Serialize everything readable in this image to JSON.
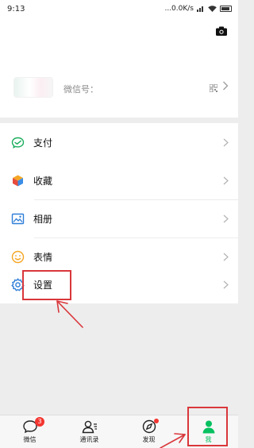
{
  "status_bar": {
    "time": "9:13",
    "network_speed": "...0.0K/s",
    "icons": [
      "signal-icon",
      "wifi-icon",
      "battery-icon"
    ]
  },
  "profile": {
    "wechat_id_label": "微信号：",
    "icons": [
      "camera-icon",
      "qr-code-icon",
      "chevron-right-icon"
    ]
  },
  "menu": {
    "pay": {
      "label": "支付",
      "icon": "wallet-icon"
    },
    "favorites": {
      "label": "收藏",
      "icon": "cube-icon"
    },
    "album": {
      "label": "相册",
      "icon": "image-icon"
    },
    "stickers": {
      "label": "表情",
      "icon": "smiley-icon"
    },
    "settings": {
      "label": "设置",
      "icon": "gear-icon"
    }
  },
  "tab_bar": {
    "tabs": [
      {
        "label": "微信",
        "icon": "chat-icon",
        "badge": "3"
      },
      {
        "label": "通讯录",
        "icon": "contacts-icon"
      },
      {
        "label": "发现",
        "icon": "compass-icon",
        "dot": true
      },
      {
        "label": "我",
        "icon": "person-icon",
        "active": true
      }
    ]
  },
  "colors": {
    "accent_green": "#07c160",
    "annotation_red": "#d9373b",
    "badge_red": "#f43530",
    "background": "#ededed"
  }
}
